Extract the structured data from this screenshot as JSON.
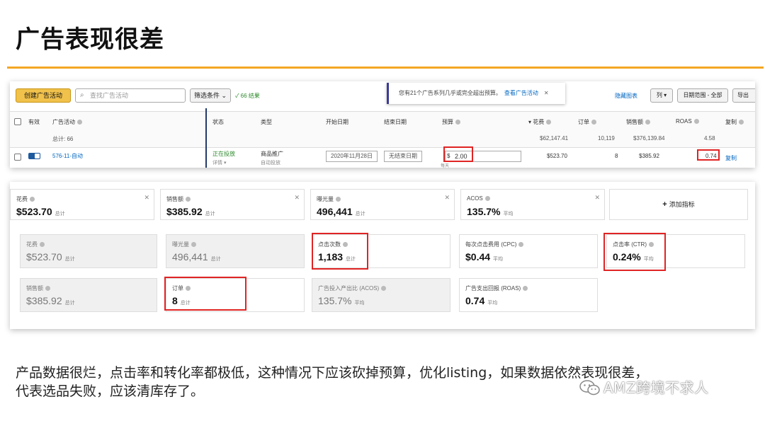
{
  "slide": {
    "title": "广告表现很差",
    "caption_line1": "产品数据很烂，点击率和转化率都极低，这种情况下应该砍掉预算，优化listing，如果数据依然表现很差，",
    "caption_line2": "代表选品失败，应该清库存了。",
    "watermark": "AMZ跨境不求人",
    "accent_color": "#f4a723",
    "highlight_color": "#e02424"
  },
  "toolbar": {
    "create_label": "创建广告活动",
    "search_placeholder": "查找广告活动",
    "filter_label": "筛选条件 ⌄",
    "result_count": "✓ 66 结果",
    "notice_text": "您有21个广告系列几乎或完全超出预算。",
    "notice_link": "查看广告活动",
    "notice_close": "✕",
    "hide_chart": "隐藏图表",
    "columns_label": "列 ▾",
    "date_range": "日期范围 - 全部",
    "export_label": "导出"
  },
  "table": {
    "headers": {
      "active": "有效",
      "campaign": "广告活动",
      "status": "状态",
      "type": "类型",
      "start": "开始日期",
      "end": "结束日期",
      "budget": "预算",
      "spend": "▾ 花费",
      "orders": "订单",
      "sales": "销售额",
      "roas": "ROAS",
      "copy": "复制"
    },
    "totals": {
      "label": "总计: 66",
      "spend": "$62,147.41",
      "orders": "10,119",
      "sales": "$376,139.84",
      "roas": "4.58"
    },
    "row": {
      "campaign": "576-11-自动",
      "status": "正在投放",
      "status_detail": "详情 ▾",
      "type": "商品推广",
      "type_detail": "自动投放",
      "start": "2020年11月28日",
      "end": "无结束日期",
      "budget_currency": "$",
      "budget": "2.00",
      "budget_note": "每天",
      "spend": "$523.70",
      "orders": "8",
      "sales": "$385.92",
      "roas": "0.74",
      "copy": "复制"
    }
  },
  "summary_cards": [
    {
      "label": "花费",
      "value": "$523.70",
      "unit": "总计"
    },
    {
      "label": "销售额",
      "value": "$385.92",
      "unit": "总计"
    },
    {
      "label": "曝光量",
      "value": "496,441",
      "unit": "总计"
    },
    {
      "label": "ACOS",
      "value": "135.7%",
      "unit": "平均"
    }
  ],
  "add_metric": "添加指标",
  "metric_grid_row1": [
    {
      "label": "花费",
      "value": "$523.70",
      "unit": "总计"
    },
    {
      "label": "曝光量",
      "value": "496,441",
      "unit": "总计"
    },
    {
      "label": "点击次数",
      "value": "1,183",
      "unit": "总计"
    },
    {
      "label": "每次点击费用 (CPC)",
      "value": "$0.44",
      "unit": "平均"
    },
    {
      "label": "点击率 (CTR)",
      "value": "0.24%",
      "unit": "平均"
    }
  ],
  "metric_grid_row2": [
    {
      "label": "销售额",
      "value": "$385.92",
      "unit": "总计"
    },
    {
      "label": "订单",
      "value": "8",
      "unit": "总计"
    },
    {
      "label": "广告投入产出比 (ACOS)",
      "value": "135.7%",
      "unit": "平均"
    },
    {
      "label": "广告支出回报 (ROAS)",
      "value": "0.74",
      "unit": "平均"
    }
  ]
}
